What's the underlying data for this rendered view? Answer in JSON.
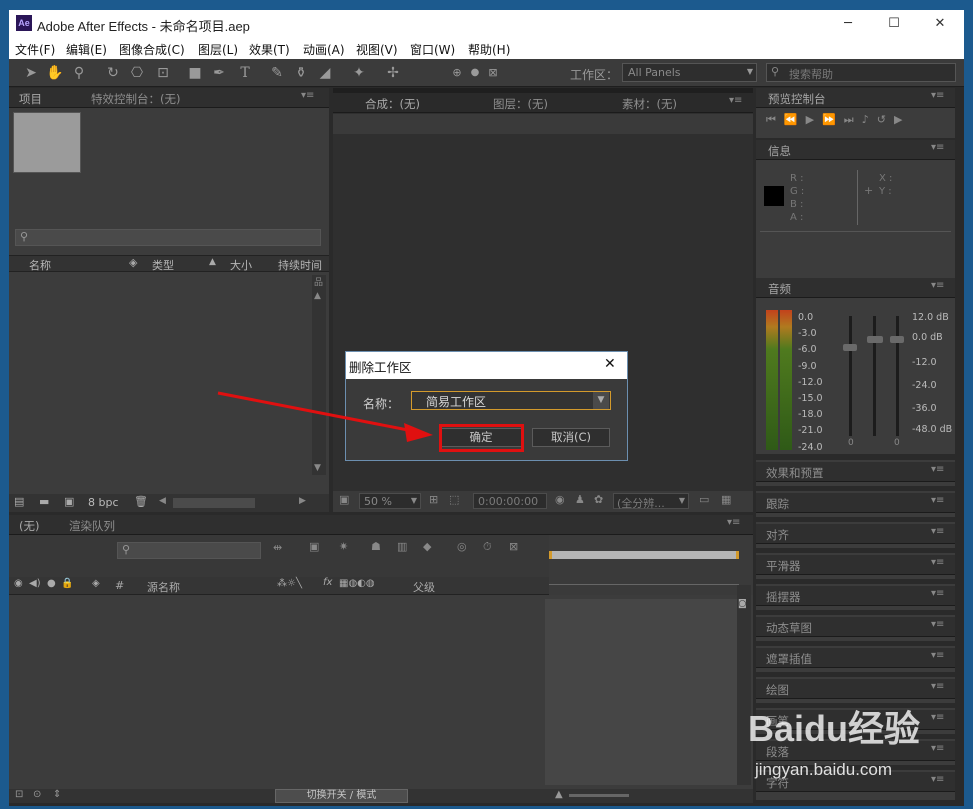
{
  "app": {
    "title": "Adobe After Effects - 未命名项目.aep",
    "logo": "Ae"
  },
  "window_buttons": {
    "minimize": "─",
    "maximize": "☐",
    "close": "✕"
  },
  "menu": [
    "文件(F)",
    "编辑(E)",
    "图像合成(C)",
    "图层(L)",
    "效果(T)",
    "动画(A)",
    "视图(V)",
    "窗口(W)",
    "帮助(H)"
  ],
  "toolbar": {
    "workspace_label": "工作区：",
    "workspace_value": "All Panels",
    "search_placeholder": "搜索帮助"
  },
  "project_panel": {
    "tab": "项目",
    "tab2": "特效控制台：(无)",
    "columns": [
      "名称",
      "类型",
      "大小",
      "持续时间"
    ],
    "bit_depth": "8 bpc"
  },
  "comp_panel": {
    "tabs": [
      "合成：(无)",
      "图层：(无)",
      "素材：(无)"
    ],
    "zoom": "50 %",
    "timecode": "0:00:00:00",
    "resolution": "(全分辨..."
  },
  "timeline_panel": {
    "tabs": [
      "(无)",
      "渲染队列"
    ],
    "source_name": "源名称",
    "parent": "父级",
    "toggle_label": "切换开关 / 模式",
    "hash": "#"
  },
  "right_panels": {
    "preview": "预览控制台",
    "info": "信息",
    "info_labels": {
      "r": "R :",
      "g": "G :",
      "b": "B :",
      "a": "A :",
      "x": "X :",
      "y": "Y :"
    },
    "audio": "音频",
    "audio_left_scale": [
      "0.0",
      "-3.0",
      "-6.0",
      "-9.0",
      "-12.0",
      "-15.0",
      "-18.0",
      "-21.0",
      "-24.0"
    ],
    "audio_right_scale": [
      "12.0 dB",
      "0.0 dB",
      "-12.0",
      "-24.0",
      "-36.0",
      "-48.0 dB"
    ],
    "audio_zero": "0",
    "stack": [
      "效果和预置",
      "跟踪",
      "对齐",
      "平滑器",
      "摇摆器",
      "动态草图",
      "遮罩插值",
      "绘图",
      "画笔",
      "段落",
      "字符"
    ]
  },
  "dialog": {
    "title": "删除工作区",
    "close": "✕",
    "name_label": "名称：",
    "name_value": "简易工作区",
    "ok": "确定",
    "cancel": "取消(C)"
  },
  "watermark": {
    "logo": "Baidu经验",
    "url": "jingyan.baidu.com"
  },
  "colors": {
    "annotation_red": "#e01010",
    "ae_logo_bg": "#2b1658",
    "highlight_orange": "#d39a2c"
  }
}
